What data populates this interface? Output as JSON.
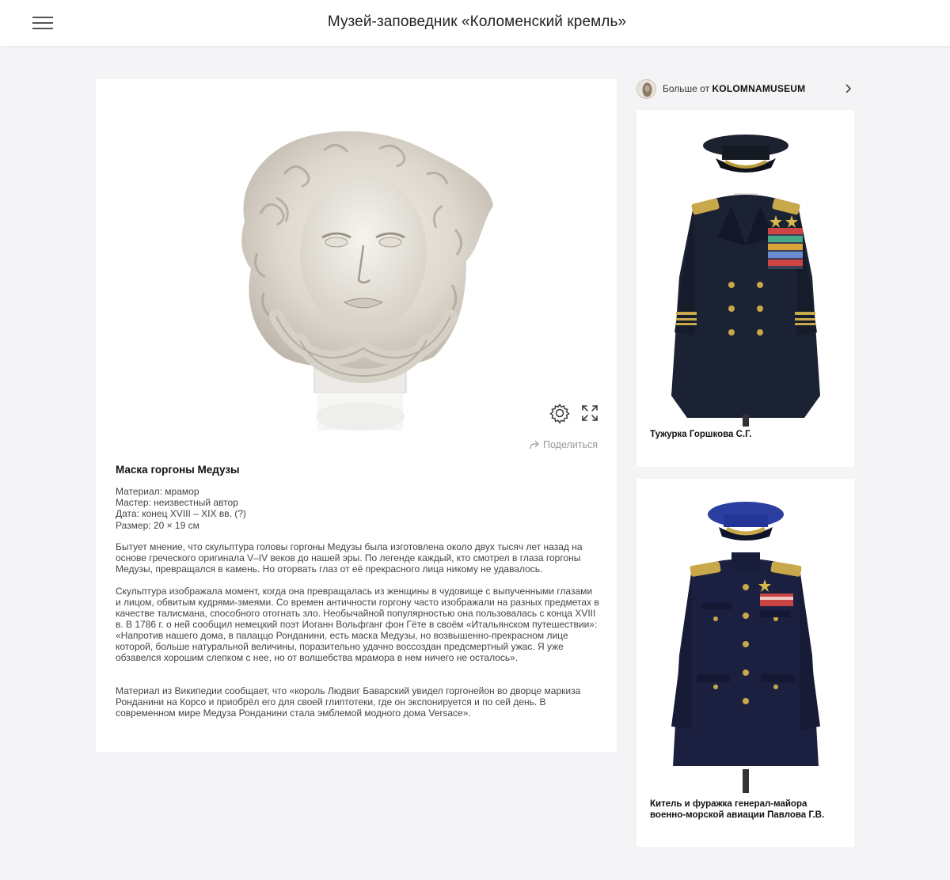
{
  "header": {
    "menu_icon": "hamburger-menu-icon",
    "title": "Музей-заповедник «Коломенский кремль»"
  },
  "viewer": {
    "settings_icon": "gear-icon",
    "fullscreen_icon": "fullscreen-icon",
    "share_icon": "share-arrow-icon",
    "share_label": "Поделиться"
  },
  "item": {
    "title": "Маска горгоны Медузы",
    "specs": [
      "Материал: мрамор",
      "Мастер: неизвестный автор",
      "Дата: конец XVIII – XIX вв. (?)",
      "Размер: 20 × 19 см"
    ],
    "paragraphs": [
      "Бытует мнение, что скульптура головы горгоны Медузы была изготовлена около двух тысяч лет назад на основе греческого оригинала V–IV веков до нашей эры. По легенде каждый, кто смотрел в глаза горгоны Медузы, превращался в камень. Но оторвать глаз от её прекрасного лица никому не удавалось.",
      "Скульптура изображала момент, когда она превращалась из женщины в чудовище с выпученными глазами и лицом, обвитым кудрями-змеями. Со времен античности горгону часто изображали на разных предметах в качестве талисмана, способного отогнать зло. Необычайной популярностью она пользовалась с конца XVIII в. В 1786 г. о ней сообщил немецкий поэт Иоганн Вольфганг фон Гёте в своём «Итальянском путешествии»: «Напротив нашего дома, в палаццо Ронданини, есть маска Медузы, но возвышенно-прекрасном лице которой, больше натуральной величины, поразительно удачно воссоздан предсмертный ужас. Я уже обзавелся хорошим слепком с нее, но от волшебства мрамора в нем ничего не осталось».",
      "Материал из Википедии сообщает, что «король Людвиг Баварский увидел горгонейон во дворце маркиза Ронданини на Корсо и приобрёл его для своей глиптотеки, где он экспонируется и по сей день. В современном мире Медуза Ронданини стала эмблемой модного дома Versace»."
    ]
  },
  "sidebar": {
    "more_prefix": "Больше от",
    "more_org": "KOLOMNAMUSEUM",
    "chevron_icon": "chevron-right-icon",
    "related": [
      {
        "caption": "Тужурка Горшкова С.Г."
      },
      {
        "caption": "Китель и фуражка генерал-майора военно-морской авиации Павлова Г.В."
      }
    ]
  }
}
